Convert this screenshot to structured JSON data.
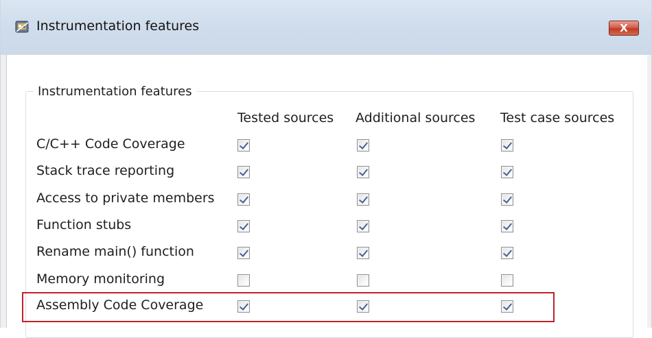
{
  "window": {
    "title": "Instrumentation features",
    "close_label": "X"
  },
  "group": {
    "label": "Instrumentation features"
  },
  "columns": [
    "Tested sources",
    "Additional sources",
    "Test case sources"
  ],
  "rows": [
    {
      "label": "C/C++ Code Coverage",
      "checks": [
        true,
        true,
        true
      ]
    },
    {
      "label": "Stack trace reporting",
      "checks": [
        true,
        true,
        true
      ]
    },
    {
      "label": "Access to private members",
      "checks": [
        true,
        true,
        true
      ]
    },
    {
      "label": "Function stubs",
      "checks": [
        true,
        true,
        true
      ]
    },
    {
      "label": "Rename main() function",
      "checks": [
        true,
        true,
        true
      ]
    },
    {
      "label": "Memory monitoring",
      "checks": [
        false,
        false,
        false
      ]
    },
    {
      "label": "Assembly Code Coverage",
      "checks": [
        true,
        true,
        true
      ]
    }
  ],
  "highlighted_row": "Assembly Code Coverage",
  "colors": {
    "highlight": "#c3202a",
    "checkmark": "#4a5f97",
    "close_button": "#c03a24"
  }
}
